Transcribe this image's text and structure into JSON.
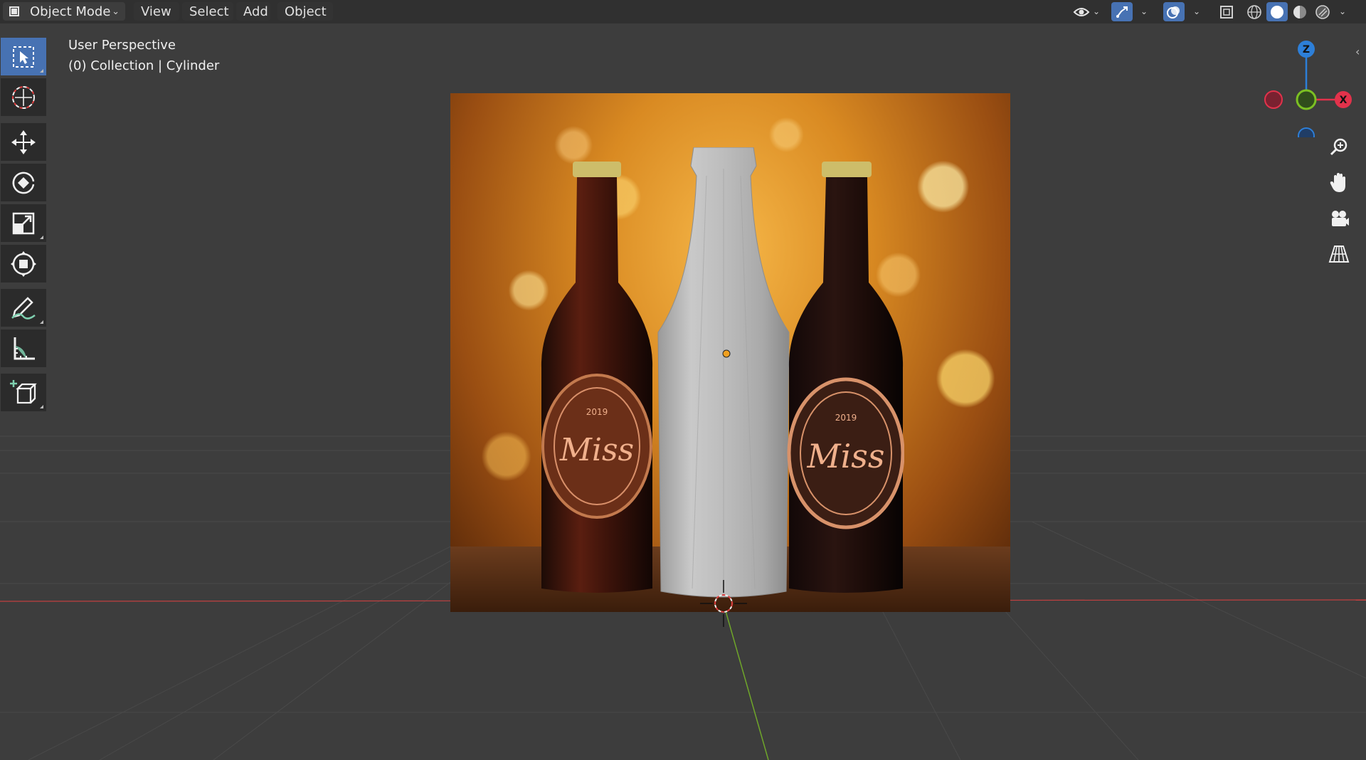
{
  "header": {
    "mode_label": "Object Mode",
    "menus": [
      "View",
      "Select",
      "Add",
      "Object"
    ]
  },
  "viewport": {
    "perspective_label": "User Perspective",
    "collection_label": "(0) Collection | Cylinder"
  },
  "gizmo": {
    "z_label": "Z",
    "x_label": "X"
  },
  "toolbar": {
    "tools": [
      "select-box",
      "cursor",
      "move",
      "rotate",
      "scale",
      "transform",
      "annotate",
      "measure",
      "add-cube"
    ],
    "active_tool": "select-box"
  },
  "reference_image": {
    "label_text": "Miss",
    "year_text": "2019"
  },
  "colors": {
    "accent": "#4772b3",
    "x_axis": "#e2324b",
    "y_axis": "#7cc023",
    "z_axis": "#2d7fd8",
    "header_bg": "#303030",
    "viewport_bg": "#3d3d3d"
  }
}
